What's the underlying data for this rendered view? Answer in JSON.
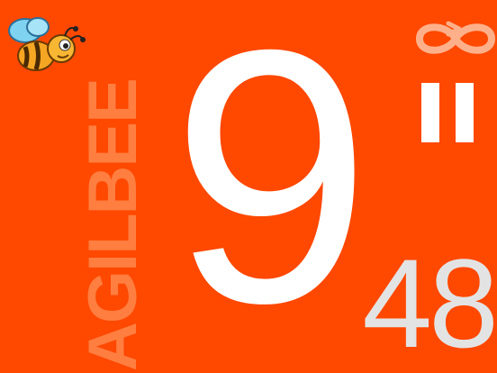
{
  "app": {
    "brand_text": "AGILBEE",
    "logo_icon": "bee-icon"
  },
  "timer": {
    "main_value": "9",
    "secondary_value": "48"
  },
  "controls": {
    "loop_icon": "infinity-icon",
    "pause_icon": "pause-icon"
  },
  "colors": {
    "background": "#ff4800",
    "brand_text": "#ff7e40",
    "main_number": "#ffffff",
    "secondary_number": "#e3e3e3",
    "bee_body": "#f5a623",
    "bee_wing": "#7fd3f0"
  }
}
